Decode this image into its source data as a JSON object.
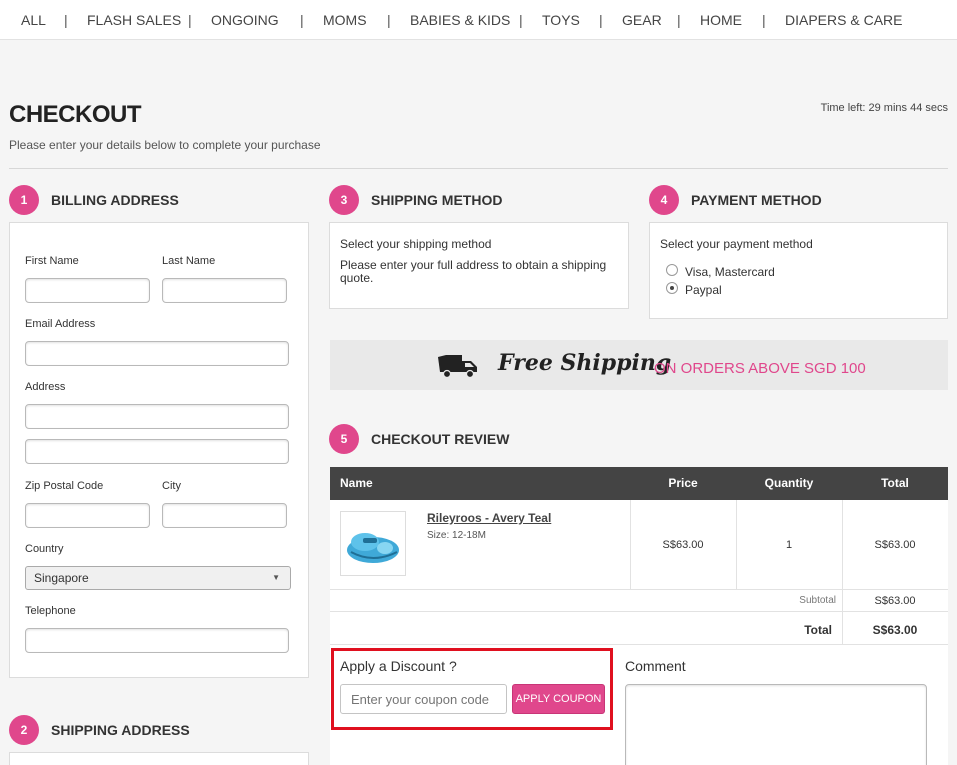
{
  "nav": {
    "items": [
      "ALL",
      "FLASH SALES",
      "ONGOING",
      "MOMS",
      "BABIES & KIDS",
      "TOYS",
      "GEAR",
      "HOME",
      "DIAPERS & CARE"
    ],
    "separator": "|"
  },
  "header": {
    "title": "CHECKOUT",
    "subtitle": "Please enter your details below to complete your purchase",
    "time_left": "Time left: 29 mins 44 secs"
  },
  "billing": {
    "step": "1",
    "title": "BILLING ADDRESS",
    "first_name_label": "First Name",
    "last_name_label": "Last Name",
    "email_label": "Email Address",
    "address_label": "Address",
    "zip_label": "Zip Postal Code",
    "city_label": "City",
    "country_label": "Country",
    "country_value": "Singapore",
    "telephone_label": "Telephone"
  },
  "shipping_address": {
    "step": "2",
    "title": "SHIPPING ADDRESS"
  },
  "shipping_method": {
    "step": "3",
    "title": "SHIPPING METHOD",
    "prompt": "Select your shipping method",
    "note": "Please enter your full address to obtain a shipping quote."
  },
  "payment_method": {
    "step": "4",
    "title": "PAYMENT METHOD",
    "prompt": "Select your payment method",
    "options": [
      {
        "label": "Visa, Mastercard",
        "selected": false
      },
      {
        "label": "Paypal",
        "selected": true
      }
    ]
  },
  "banner": {
    "script_text": "Free Shipping",
    "note": "ON ORDERS ABOVE SGD 100"
  },
  "review": {
    "step": "5",
    "title": "CHECKOUT REVIEW",
    "columns": [
      "Name",
      "Price",
      "Quantity",
      "Total"
    ],
    "items": [
      {
        "name": "Rileyroos - Avery Teal",
        "size": "Size: 12-18M",
        "price": "S$63.00",
        "quantity": "1",
        "total": "S$63.00"
      }
    ],
    "subtotal_label": "Subtotal",
    "subtotal_value": "S$63.00",
    "total_label": "Total",
    "total_value": "S$63.00"
  },
  "discount": {
    "title": "Apply a Discount ?",
    "placeholder": "Enter your coupon code",
    "button": "APPLY COUPON"
  },
  "comment": {
    "label": "Comment"
  },
  "colors": {
    "accent": "#e0478c",
    "highlight": "#e0101f",
    "table_header": "#444444"
  },
  "icons": [
    "truck-icon",
    "chevron-down-icon",
    "product-image"
  ]
}
